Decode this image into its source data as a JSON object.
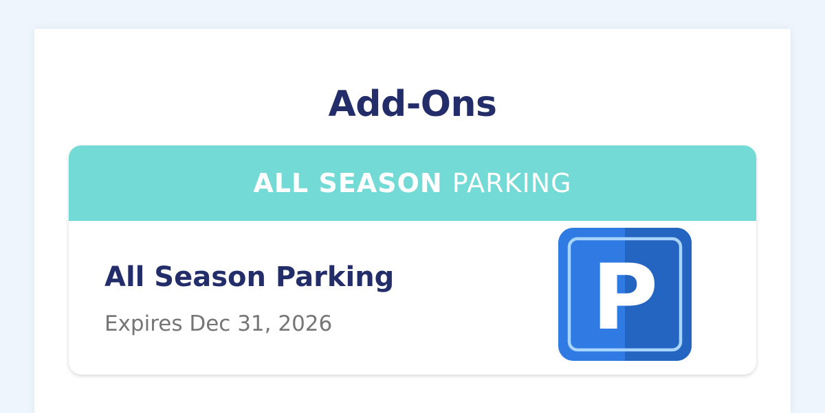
{
  "addons": {
    "title": "Add-Ons",
    "card": {
      "header_bold": "ALL SEASON",
      "header_light": "PARKING",
      "name": "All Season Parking",
      "expiry": "Expires Dec 31, 2026",
      "icon": "parking-icon",
      "icon_letter": "P"
    }
  },
  "colors": {
    "page_background": "#eef5fd",
    "title_text": "#232d6a",
    "header_background": "#73dad5",
    "expiry_text": "#757575",
    "icon_blue": "#2f7be3",
    "icon_blue_dark": "#2565c2"
  }
}
